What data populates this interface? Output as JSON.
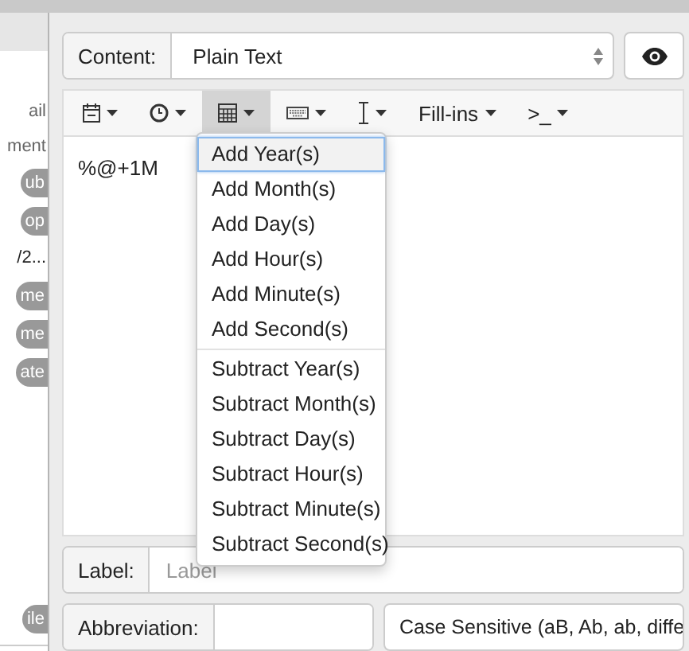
{
  "sidebar": {
    "items": [
      {
        "kind": "text",
        "label": "ail"
      },
      {
        "kind": "text",
        "label": "ment"
      },
      {
        "kind": "pill",
        "label": "ub"
      },
      {
        "kind": "pill",
        "label": "op"
      },
      {
        "kind": "text",
        "label": "/2..."
      },
      {
        "kind": "pill",
        "label": "me"
      },
      {
        "kind": "pill",
        "label": "me"
      },
      {
        "kind": "pill",
        "label": "ate"
      }
    ],
    "bottom_badge": "ile"
  },
  "content": {
    "label": "Content:",
    "value": "Plain Text"
  },
  "toolbar": [
    {
      "kind": "calendar",
      "selected": false
    },
    {
      "kind": "clock",
      "selected": false
    },
    {
      "kind": "calculator",
      "selected": true
    },
    {
      "kind": "keyboard",
      "selected": false
    },
    {
      "kind": "cursor",
      "selected": false
    },
    {
      "kind": "text",
      "label": "Fill-ins",
      "selected": false
    },
    {
      "kind": "text",
      "label": ">_",
      "selected": false
    }
  ],
  "editor": {
    "value": "%@+1M"
  },
  "menu": {
    "groups": [
      [
        {
          "label": "Add Year(s)",
          "selected": true
        },
        {
          "label": "Add Month(s)",
          "selected": false
        },
        {
          "label": "Add Day(s)",
          "selected": false
        },
        {
          "label": "Add Hour(s)",
          "selected": false
        },
        {
          "label": "Add Minute(s)",
          "selected": false
        },
        {
          "label": "Add Second(s)",
          "selected": false
        }
      ],
      [
        {
          "label": "Subtract Year(s)",
          "selected": false
        },
        {
          "label": "Subtract Month(s)",
          "selected": false
        },
        {
          "label": "Subtract Day(s)",
          "selected": false
        },
        {
          "label": "Subtract Hour(s)",
          "selected": false
        },
        {
          "label": "Subtract Minute(s)",
          "selected": false
        },
        {
          "label": "Subtract Second(s)",
          "selected": false
        }
      ]
    ]
  },
  "label_field": {
    "label": "Label:",
    "placeholder": "Label"
  },
  "abbreviation": {
    "label": "Abbreviation:"
  },
  "case_select": {
    "value": "Case Sensitive (aB, Ab, ab, diffe"
  }
}
